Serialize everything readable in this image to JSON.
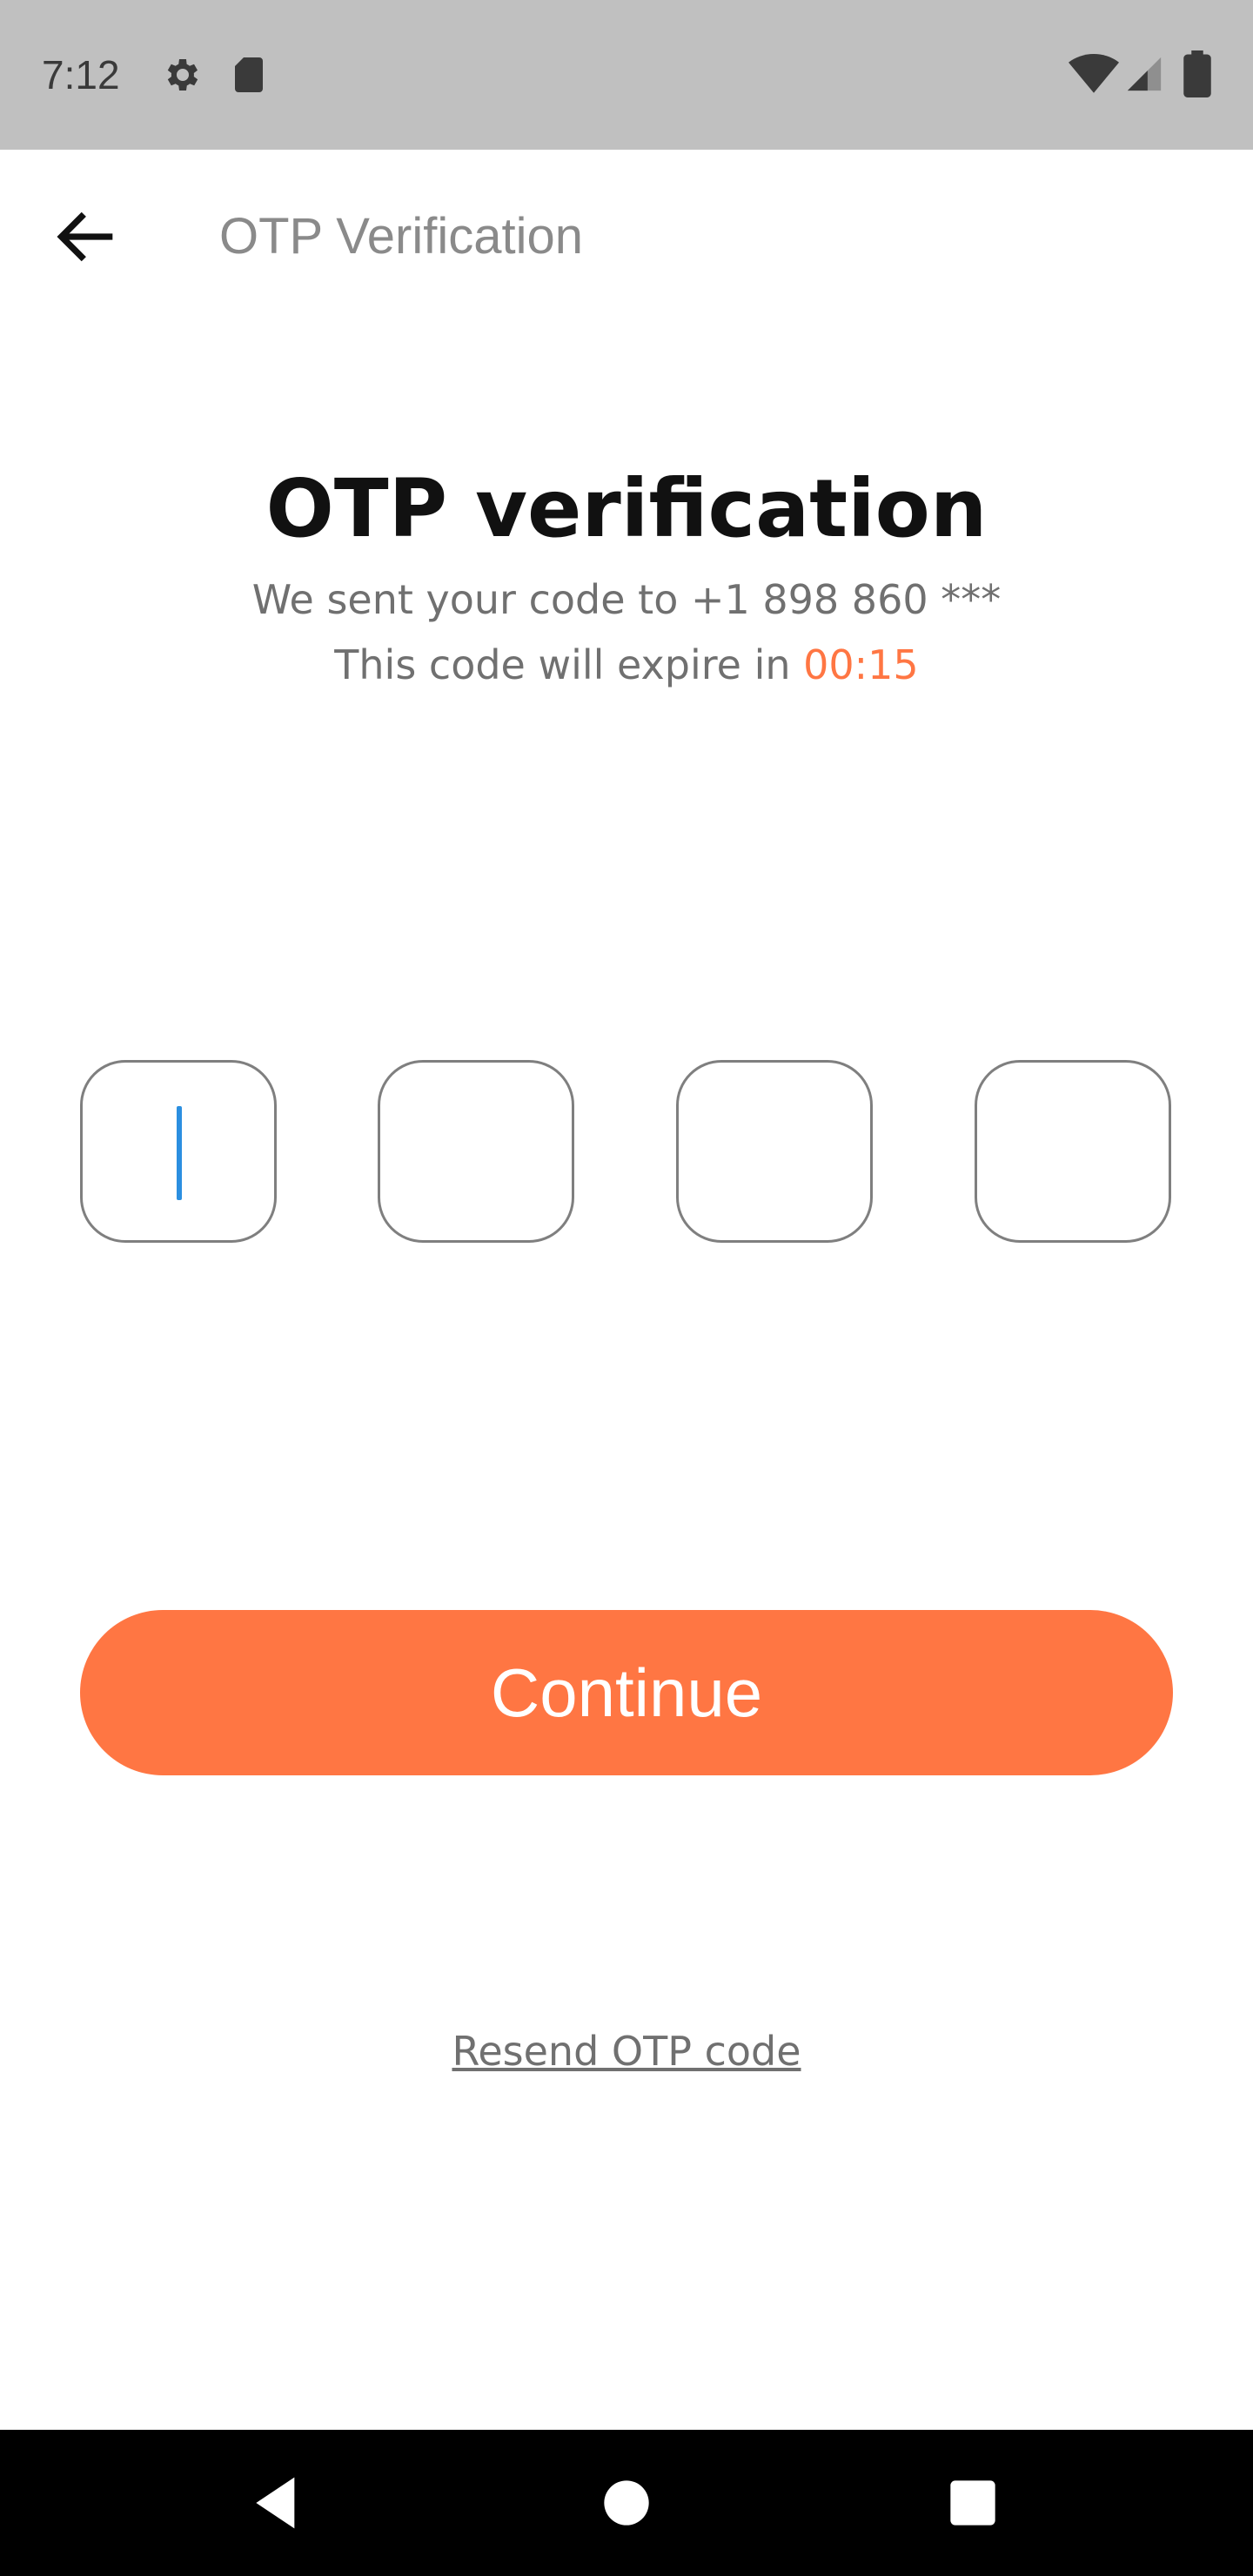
{
  "status_bar": {
    "time": "7:12",
    "icons_left": [
      "gear-icon",
      "sd-card-icon"
    ],
    "icons_right": [
      "wifi-icon",
      "cell-signal-icon",
      "battery-icon"
    ]
  },
  "app_bar": {
    "title": "OTP Verification",
    "back_icon": "arrow-left-icon"
  },
  "content": {
    "heading": "OTP verification",
    "sent_text": "We sent your code to +1 898 860 ***",
    "expire_text": "This code will expire in",
    "timer": "00:15"
  },
  "otp": {
    "digits": [
      "",
      "",
      "",
      ""
    ]
  },
  "continue_label": "Continue",
  "resend_label": "Resend OTP code",
  "nav_bar": {
    "icons": [
      "back-triangle-icon",
      "home-circle-icon",
      "recents-square-icon"
    ]
  },
  "colors": {
    "accent": "#ff7643",
    "caret": "#2b8fe0",
    "status_bar": "#c0c0c0",
    "nav_bar": "#000000"
  }
}
